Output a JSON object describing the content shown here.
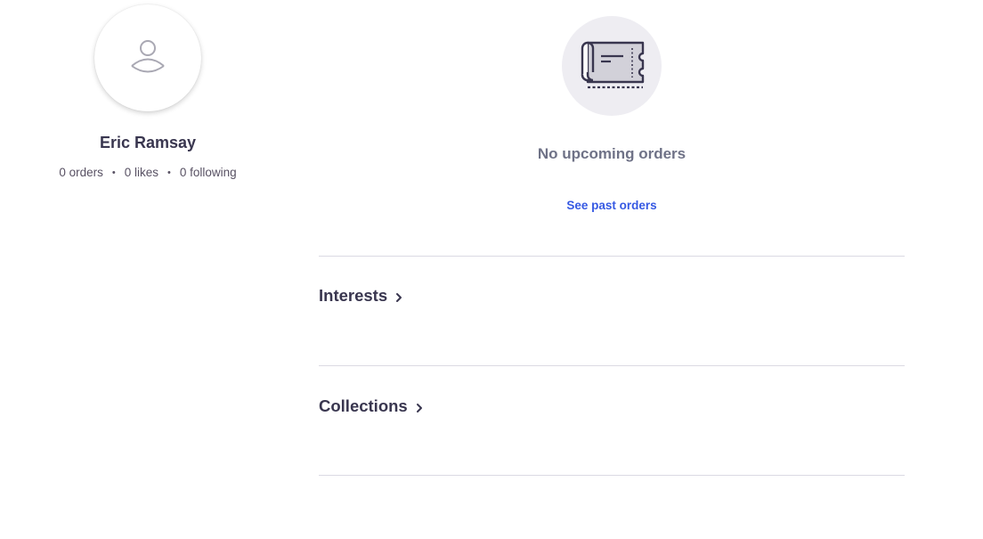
{
  "profile": {
    "name": "Eric Ramsay",
    "stats": {
      "orders": "0 orders",
      "likes": "0 likes",
      "following": "0 following",
      "separator": "•"
    },
    "avatar_icon": "user-placeholder-icon"
  },
  "orders": {
    "empty_icon": "ticket-icon",
    "empty_title": "No upcoming orders",
    "past_orders_link": "See past orders"
  },
  "sections": {
    "interests": {
      "title": "Interests",
      "icon": "chevron-right-icon"
    },
    "collections": {
      "title": "Collections",
      "icon": "chevron-right-icon"
    }
  },
  "colors": {
    "text_primary": "#39364f",
    "text_secondary": "#6f7287",
    "link": "#3659e3",
    "divider": "#dbdae3",
    "icon_circle": "#eeedf2"
  }
}
